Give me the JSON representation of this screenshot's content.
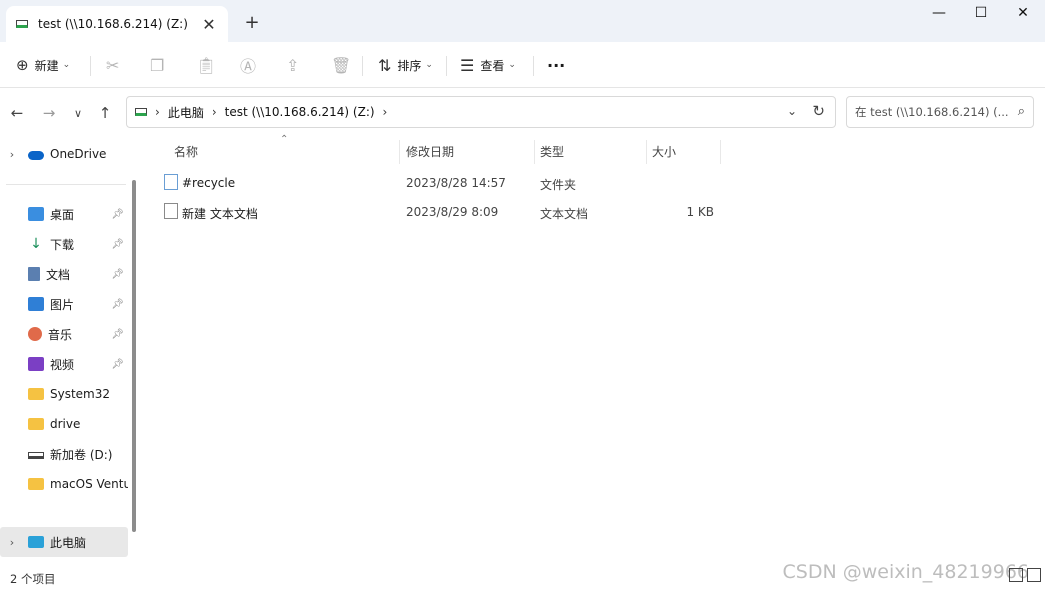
{
  "tab": {
    "title": "test (\\\\10.168.6.214) (Z:)",
    "close": "✕",
    "new_tab": "+"
  },
  "window_controls": {
    "minimize": "—",
    "maximize": "☐",
    "close": "✕"
  },
  "toolbar": {
    "new_label": "新建",
    "sort_label": "排序",
    "view_label": "查看",
    "more": "···"
  },
  "nav": {
    "back": "←",
    "forward": "→",
    "recent": "∨",
    "up": "↑"
  },
  "address": {
    "crumbs": [
      "此电脑",
      "test (\\\\10.168.6.214) (Z:)"
    ],
    "separator": "›"
  },
  "search": {
    "placeholder": "在 test (\\\\10.168.6.214) (..."
  },
  "sidebar": {
    "onedrive": "OneDrive",
    "items": [
      {
        "label": "桌面",
        "icon": "desktop-icon",
        "pinned": true
      },
      {
        "label": "下载",
        "icon": "download-icon",
        "pinned": true
      },
      {
        "label": "文档",
        "icon": "documents-icon",
        "pinned": true
      },
      {
        "label": "图片",
        "icon": "pictures-icon",
        "pinned": true
      },
      {
        "label": "音乐",
        "icon": "music-icon",
        "pinned": true
      },
      {
        "label": "视频",
        "icon": "videos-icon",
        "pinned": true
      },
      {
        "label": "System32",
        "icon": "folder-icon",
        "pinned": false
      },
      {
        "label": "drive",
        "icon": "folder-icon",
        "pinned": false
      },
      {
        "label": "新加卷 (D:)",
        "icon": "drive-icon",
        "pinned": false
      },
      {
        "label": "macOS Ventura",
        "icon": "folder-icon",
        "pinned": false
      }
    ],
    "this_pc": "此电脑"
  },
  "columns": {
    "name": "名称",
    "modified": "修改日期",
    "type": "类型",
    "size": "大小"
  },
  "files": [
    {
      "name": "#recycle",
      "modified": "2023/8/28 14:57",
      "type": "文件夹",
      "size": ""
    },
    {
      "name": "新建 文本文档",
      "modified": "2023/8/29 8:09",
      "type": "文本文档",
      "size": "1 KB"
    }
  ],
  "status": {
    "count": "2 个项目"
  },
  "watermark": "CSDN @weixin_48219966",
  "colors": {
    "accent": "#0067c0",
    "tabbar_bg": "#eef2f8",
    "folder": "#f5c242",
    "drive_green": "#2da44e"
  }
}
